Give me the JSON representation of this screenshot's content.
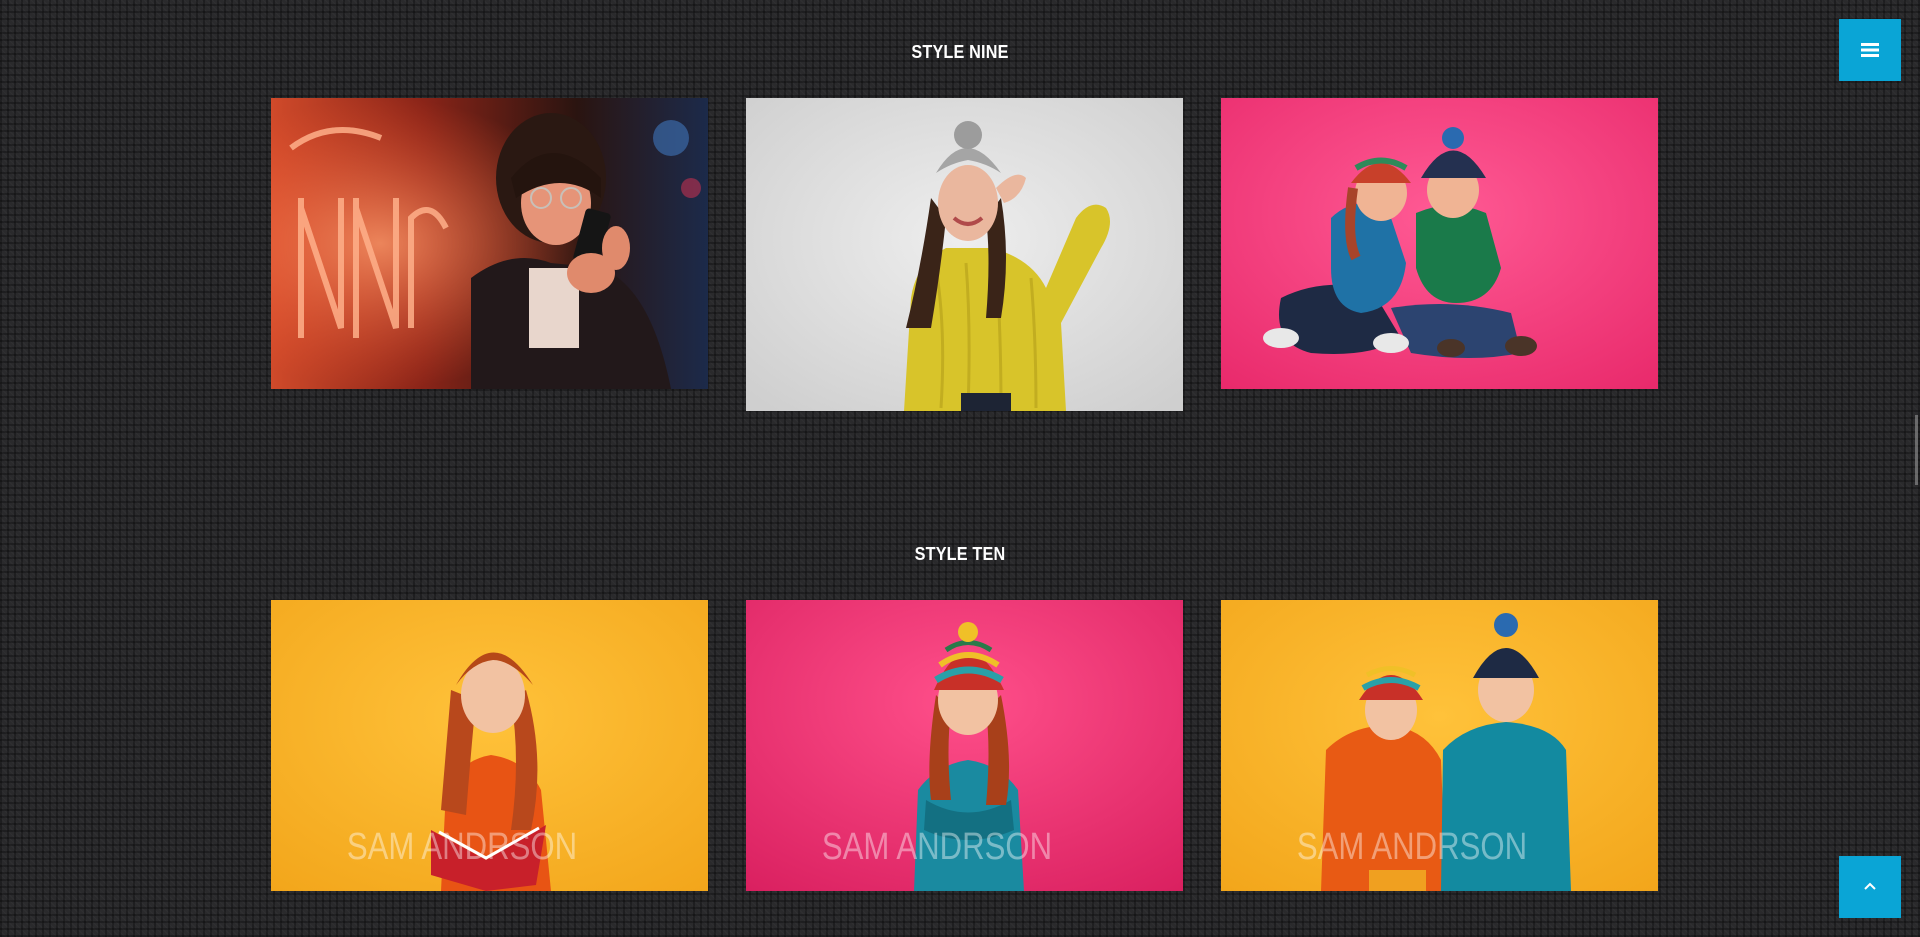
{
  "sections": {
    "nine": {
      "title": "STYLE NINE"
    },
    "ten": {
      "title": "STYLE TEN"
    }
  },
  "gallery_ten": {
    "captions": [
      "SAM ANDRSON",
      "SAM ANDRSON",
      "SAM ANDRSON"
    ]
  },
  "icons": {
    "menu": "hamburger-menu-icon",
    "scroll_top": "chevron-up-icon"
  },
  "colors": {
    "accent": "#0aa5d6",
    "background": "#2a2a2c",
    "title": "#ffffff"
  }
}
